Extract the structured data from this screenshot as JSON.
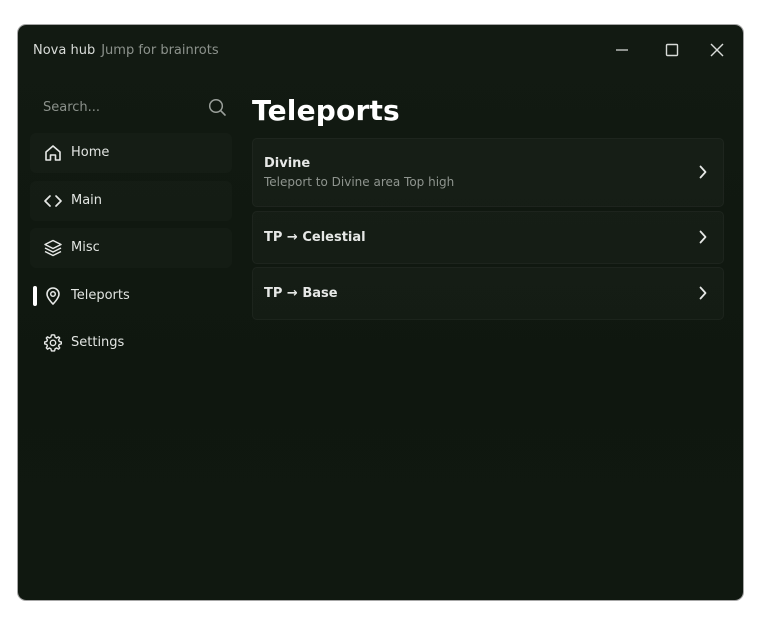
{
  "window": {
    "title": "Nova hub",
    "subtitle": "Jump for brainrots"
  },
  "search": {
    "placeholder": "Search..."
  },
  "sidebar": {
    "items": [
      {
        "label": "Home",
        "icon": "home-icon"
      },
      {
        "label": "Main",
        "icon": "code-icon"
      },
      {
        "label": "Misc",
        "icon": "layers-icon"
      },
      {
        "label": "Teleports",
        "icon": "map-pin-icon",
        "active": true
      },
      {
        "label": "Settings",
        "icon": "gear-icon"
      }
    ]
  },
  "main": {
    "title": "Teleports",
    "buttons": [
      {
        "label": "Divine",
        "description": "Teleport to Divine area Top high"
      },
      {
        "label": "TP → Celestial"
      },
      {
        "label": "TP → Base"
      }
    ]
  },
  "colors": {
    "window_bg": "#101810",
    "text": "#e6e8e6",
    "muted_text": "#8f958f",
    "active_indicator": "#ffffff"
  }
}
